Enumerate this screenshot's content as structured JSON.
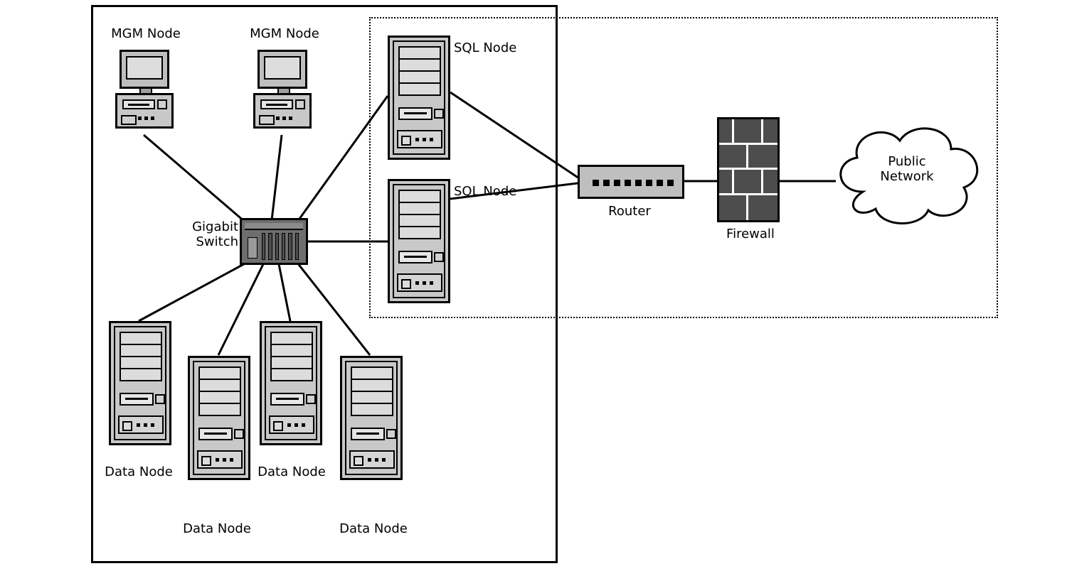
{
  "diagram": {
    "zones": {
      "cluster_box": "cluster-private-box",
      "dmz_box": "dmz-dotted-box"
    },
    "nodes": {
      "mgm1": {
        "label": "MGM Node",
        "type": "pc"
      },
      "mgm2": {
        "label": "MGM Node",
        "type": "pc"
      },
      "sql1": {
        "label": "SQL Node",
        "type": "server"
      },
      "sql2": {
        "label": "SQL Node",
        "type": "server"
      },
      "data1": {
        "label": "Data Node",
        "type": "server"
      },
      "data2": {
        "label": "Data Node",
        "type": "server"
      },
      "data3": {
        "label": "Data Node",
        "type": "server"
      },
      "data4": {
        "label": "Data Node",
        "type": "server"
      },
      "switch": {
        "label": "Gigabit\nSwitch",
        "type": "switch"
      },
      "router": {
        "label": "Router",
        "type": "router"
      },
      "firewall": {
        "label": "Firewall",
        "type": "firewall"
      },
      "cloud": {
        "label": "Public\nNetwork",
        "type": "cloud"
      }
    },
    "links": [
      [
        "mgm1",
        "switch"
      ],
      [
        "mgm2",
        "switch"
      ],
      [
        "sql1",
        "switch"
      ],
      [
        "sql2",
        "switch"
      ],
      [
        "data1",
        "switch"
      ],
      [
        "data2",
        "switch"
      ],
      [
        "data3",
        "switch"
      ],
      [
        "data4",
        "switch"
      ],
      [
        "sql1",
        "router"
      ],
      [
        "sql2",
        "router"
      ],
      [
        "router",
        "firewall"
      ],
      [
        "firewall",
        "cloud"
      ]
    ]
  }
}
